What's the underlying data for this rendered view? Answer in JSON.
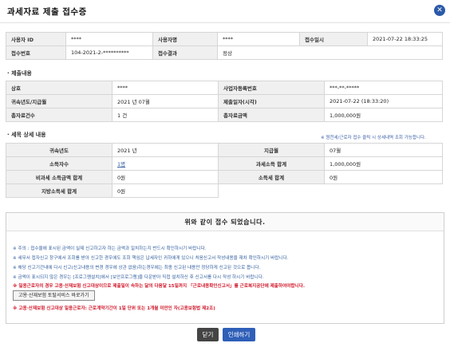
{
  "window": {
    "title": "과세자료 제출 접수증"
  },
  "receipt_info": {
    "user_id_label": "사용자 ID",
    "user_id": "****",
    "user_name_label": "사용자명",
    "user_name": "****",
    "receipt_datetime_label": "접수일시",
    "receipt_datetime": "2021-07-22 18:33:25",
    "receipt_number_label": "접수번호",
    "receipt_number": "104-2021-2-**********",
    "receipt_result_label": "접수결과",
    "receipt_result": "정상"
  },
  "submission": {
    "section_title": "제출내용",
    "trade_name_label": "상호",
    "trade_name": "****",
    "business_number_label": "사업자등록번호",
    "business_number": "***-**-*****",
    "year_month_label": "귀속년도/지급월",
    "year_month": "2021 년 07월",
    "submit_datetime_label": "제출일자(시각)",
    "submit_datetime": "2021-07-22 (18:33:20)",
    "total_count_label": "총자료건수",
    "total_count": "1 건",
    "total_amount_label": "총자료금액",
    "total_amount": "1,000,000원"
  },
  "tax_detail": {
    "section_title": "세목 상세 내용",
    "note": "※ 원천세/근로자 접수 클릭 시 상세내역 조회 가능합니다.",
    "year_label": "귀속년도",
    "year": "2021 년",
    "pay_month_label": "지급월",
    "pay_month": "07월",
    "earners_label": "소득자수",
    "earners": "1명",
    "taxable_total_label": "과세소득 합계",
    "taxable_total": "1,000,000원",
    "nontaxable_total_label": "비과세 소득금액 합계",
    "nontaxable_total": "0원",
    "income_tax_total_label": "소득세 합계",
    "income_tax_total": "0원",
    "local_tax_total_label": "지방소득세 합계",
    "local_tax_total": "0원"
  },
  "message": {
    "headline": "위와 같이 접수 되었습니다.",
    "lines": [
      "※ 주의 : 접수율에 표시된 금액이 실제 신고하고자 하는 금액과 일치하는지 반드시 확인하시기 바랍니다.",
      "※ 세무서 접자신고 창구에서 조회를 받아 신고한 경우에도 조회 책임은 납세자인 귀하에게 있으니 처음신고서 작성내용을 재차 확인하시기 바랍니다.",
      "※ 해당 신고기간내에 다시 신고(신고내용의 변경 경우에 상관 없음)하는경우에는 최종 신고된 내용만 정당하게 신고된 것으로 봅니다.",
      "※ 금액이 표시되지 않은 경우는 [프로그램설치]에서 [보안프로그램]을 다운받아 직접 설치하신 후 신고서를 다시 작성 하시기 바랍니다."
    ],
    "red_line_1": "※ 일용근로자의 경우 고용·산재보험 신고대상이므로 제출일이 속하는 달의 다음달 15일까지 「근로내용확인신고서」를 근로복지공단에 제출하여야합니다.",
    "button_label": "고용·산재보험 토탈서비스 바로가기",
    "red_line_2": "※ 고용·산재보험 신고대상 일용근로자: 근로계약기간이 1일 단위 또는 1개월 미만인 자(고용보험법 제2조)"
  },
  "buttons": {
    "close": "닫기",
    "print": "인쇄하기"
  },
  "colors": {
    "accent": "#2f5fb8",
    "warning": "#d0182a",
    "link": "#2f5d9e"
  }
}
